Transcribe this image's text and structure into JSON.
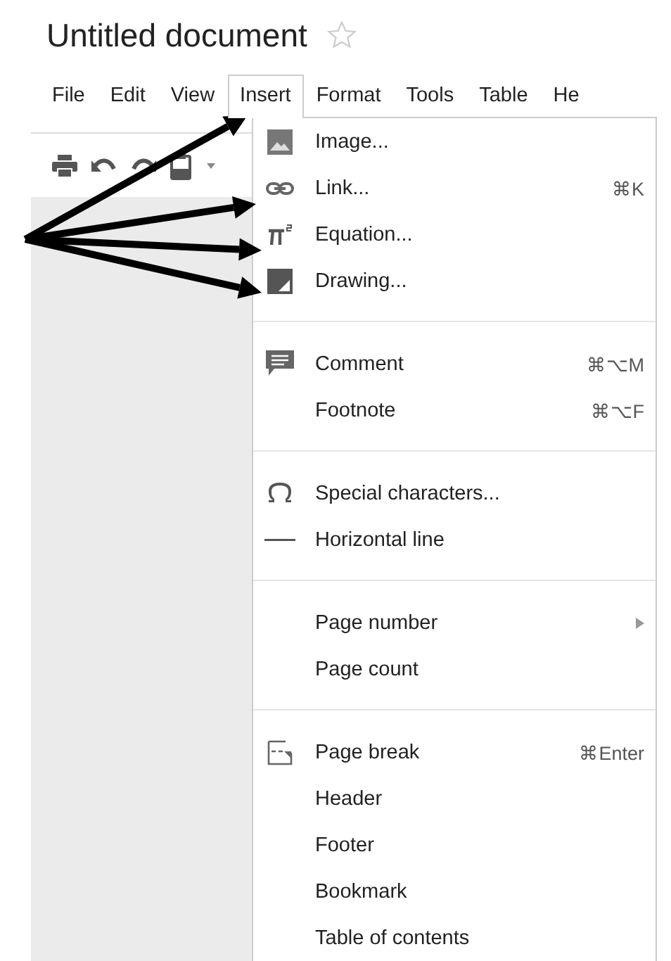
{
  "document": {
    "title": "Untitled document",
    "starred": false
  },
  "menubar": [
    {
      "label": "File",
      "selected": false
    },
    {
      "label": "Edit",
      "selected": false
    },
    {
      "label": "View",
      "selected": false
    },
    {
      "label": "Insert",
      "selected": true
    },
    {
      "label": "Format",
      "selected": false
    },
    {
      "label": "Tools",
      "selected": false
    },
    {
      "label": "Table",
      "selected": false
    },
    {
      "label": "He",
      "selected": false
    }
  ],
  "insert_menu": {
    "sections": [
      {
        "items": [
          {
            "kind": "image",
            "label": "Image..."
          },
          {
            "kind": "link",
            "label": "Link...",
            "shortcut": "⌘K"
          },
          {
            "kind": "equation",
            "label": "Equation..."
          },
          {
            "kind": "drawing",
            "label": "Drawing..."
          }
        ]
      },
      {
        "items": [
          {
            "kind": "comment",
            "label": "Comment",
            "shortcut": "⌘⌥M"
          },
          {
            "label": "Footnote",
            "shortcut": "⌘⌥F"
          }
        ]
      },
      {
        "items": [
          {
            "kind": "omega",
            "label": "Special characters..."
          },
          {
            "kind": "line",
            "label": "Horizontal line"
          }
        ]
      },
      {
        "items": [
          {
            "label": "Page number",
            "has_submenu": true
          },
          {
            "label": "Page count"
          }
        ]
      },
      {
        "items": [
          {
            "kind": "pagebreak",
            "label": "Page break",
            "shortcut": "⌘Enter"
          },
          {
            "label": "Header"
          },
          {
            "label": "Footer"
          },
          {
            "label": "Bookmark"
          },
          {
            "label": "Table of contents"
          }
        ]
      }
    ]
  }
}
